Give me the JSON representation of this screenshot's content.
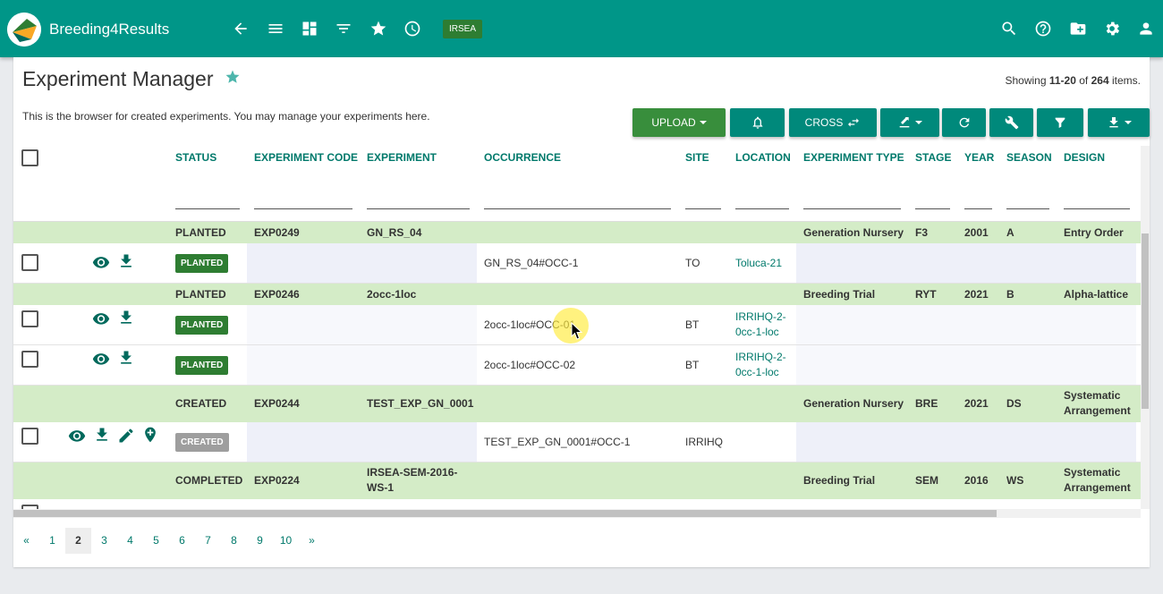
{
  "app": {
    "brand": "Breeding4Results",
    "program_badge": "IRSEA"
  },
  "nav_icons": [
    "back-arrow-icon",
    "menu-icon",
    "dashboard-icon",
    "filter-list-icon",
    "star-icon",
    "history-icon"
  ],
  "right_icons": [
    "search-icon",
    "help-icon",
    "folder-add-icon",
    "gear-icon",
    "user-icon"
  ],
  "page": {
    "title": "Experiment Manager",
    "description": "This is the browser for created experiments. You may manage your experiments here.",
    "showing_prefix": "Showing",
    "showing_range": "11-20",
    "showing_of": "of",
    "showing_total": "264",
    "showing_suffix": "items."
  },
  "toolbar": {
    "upload_label": "UPLOAD",
    "cross_label": "CROSS"
  },
  "columns": [
    "STATUS",
    "EXPERIMENT CODE",
    "EXPERIMENT",
    "OCCURRENCE",
    "SITE",
    "LOCATION",
    "EXPERIMENT TYPE",
    "STAGE",
    "YEAR",
    "SEASON",
    "DESIGN"
  ],
  "groups": [
    {
      "status": "PLANTED",
      "code": "EXP0249",
      "experiment": "GN_RS_04",
      "type": "Generation Nursery",
      "stage": "F3",
      "year": "2001",
      "season": "A",
      "design": "Entry Order"
    },
    {
      "status": "PLANTED",
      "code": "EXP0246",
      "experiment": "2occ-1loc",
      "type": "Breeding Trial",
      "stage": "RYT",
      "year": "2021",
      "season": "B",
      "design": "Alpha-lattice"
    },
    {
      "status": "CREATED",
      "code": "EXP0244",
      "experiment": "TEST_EXP_GN_0001",
      "type": "Generation Nursery",
      "stage": "BRE",
      "year": "2021",
      "season": "DS",
      "design": "Systematic Arrangement"
    },
    {
      "status": "COMPLETED",
      "code": "EXP0224",
      "experiment": "IRSEA-SEM-2016-WS-1",
      "type": "Breeding Trial",
      "stage": "SEM",
      "year": "2016",
      "season": "WS",
      "design": "Systematic Arrangement"
    }
  ],
  "occurrences": [
    {
      "status": "PLANTED",
      "occurrence": "GN_RS_04#OCC-1",
      "site": "TO",
      "location": "Toluca-21"
    },
    {
      "status": "PLANTED",
      "occurrence": "2occ-1loc#OCC-01",
      "site": "BT",
      "location": "IRRIHQ-2-0cc-1-loc"
    },
    {
      "status": "PLANTED",
      "occurrence": "2occ-1loc#OCC-02",
      "site": "BT",
      "location": "IRRIHQ-2-0cc-1-loc"
    },
    {
      "status": "CREATED",
      "occurrence": "TEST_EXP_GN_0001#OCC-1",
      "site": "IRRIHQ",
      "location": ""
    }
  ],
  "pagination": {
    "prev": "«",
    "next": "»",
    "pages": [
      "1",
      "2",
      "3",
      "4",
      "5",
      "6",
      "7",
      "8",
      "9",
      "10"
    ],
    "current": "2"
  }
}
